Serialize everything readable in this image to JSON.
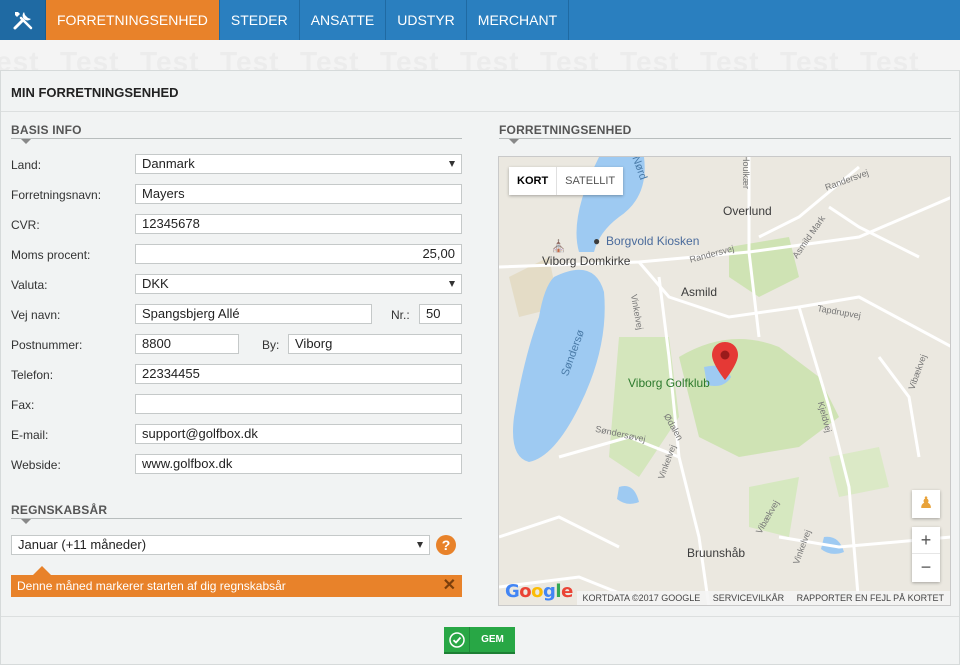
{
  "nav": {
    "tool_icon": "tools-icon",
    "tabs": [
      {
        "label": "FORRETNINGSENHED",
        "active": true
      },
      {
        "label": "STEDER"
      },
      {
        "label": "ANSATTE"
      },
      {
        "label": "UDSTYR"
      },
      {
        "label": "MERCHANT"
      }
    ]
  },
  "watermark": "Test",
  "page_title": "MIN FORRETNINGSENHED",
  "basis": {
    "title": "BASIS INFO",
    "land_label": "Land:",
    "land_value": "Danmark",
    "name_label": "Forretningsnavn:",
    "name_value": "Mayers",
    "cvr_label": "CVR:",
    "cvr_value": "12345678",
    "moms_label": "Moms procent:",
    "moms_value": "25,00",
    "valuta_label": "Valuta:",
    "valuta_value": "DKK",
    "vej_label": "Vej navn:",
    "vej_value": "Spangsbjerg Allé",
    "nr_label": "Nr.:",
    "nr_value": "50",
    "post_label": "Postnummer:",
    "post_value": "8800",
    "by_label": "By:",
    "by_value": "Viborg",
    "tlf_label": "Telefon:",
    "tlf_value": "22334455",
    "fax_label": "Fax:",
    "fax_value": "",
    "email_label": "E-mail:",
    "email_value": "support@golfbox.dk",
    "web_label": "Webside:",
    "web_value": "www.golfbox.dk"
  },
  "regnskab": {
    "title": "REGNSKABSÅR",
    "value": "Januar (+11 måneder)",
    "help": "?",
    "tip": "Denne måned markerer starten af dig regnskabsår",
    "tip_close": "✕"
  },
  "map_section": {
    "title": "FORRETNINGSENHED",
    "type_map": "KORT",
    "type_sat": "SATELLIT",
    "labels": {
      "overlund": "Overlund",
      "borgvold": "Borgvold Kiosken",
      "domkirke": "Viborg Domkirke",
      "asmild": "Asmild",
      "golfklub": "Viborg Golfklub",
      "bruunshaab": "Bruunshåb",
      "sondersoe": "Søndersø",
      "randersvej": "Randersvej",
      "randersvej2": "Randersvej",
      "houlkaer": "Houlkær",
      "asmild_mark": "Asmild Mark",
      "tapdrupvej": "Tapdrupvej",
      "vinkelvej": "Vinkelvej",
      "vinkelvej2": "Vinkelvej",
      "vinkelvej3": "Vinkelvej",
      "vibaekvej": "Vibækvej",
      "vibaekvej2": "Vibækvej",
      "kjeldvej": "Kjeldvej",
      "odalen": "Ødalen",
      "sondersoevej": "Søndersøvej",
      "nordso": "Nørd"
    },
    "zoom_in": "+",
    "zoom_out": "−",
    "google": "Google",
    "footer_data": "KORTDATA ©2017 GOOGLE",
    "footer_terms": "SERVICEVILKÅR",
    "footer_report": "RAPPORTER EN FEJL PÅ KORTET"
  },
  "save_label": "GEM",
  "colors": {
    "nav": "#2a7fbf",
    "accent": "#e8822a",
    "save": "#28a745"
  }
}
